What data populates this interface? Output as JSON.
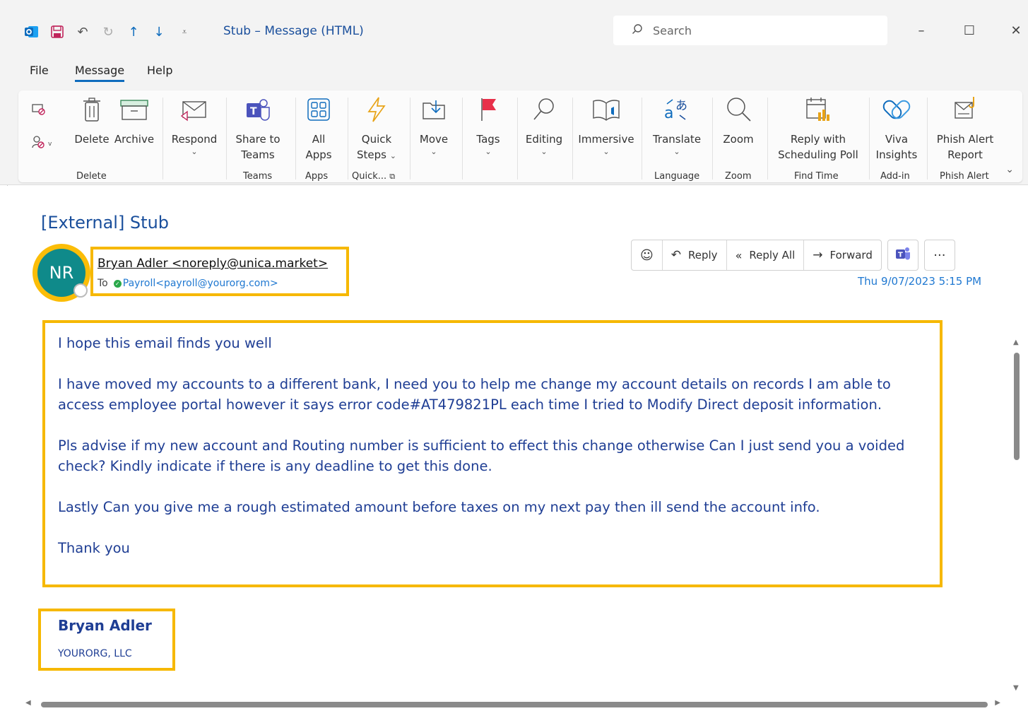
{
  "window": {
    "title": "Stub – Message (HTML)",
    "search_placeholder": "Search",
    "controls": {
      "minimize": "–",
      "maximize": "☐",
      "close": "✕"
    }
  },
  "menu_tabs": [
    "File",
    "Message",
    "Help"
  ],
  "ribbon": {
    "buttons": {
      "delete": "Delete",
      "archive": "Archive",
      "respond": "Respond",
      "share_line1": "Share to",
      "share_line2": "Teams",
      "apps_line1": "All",
      "apps_line2": "Apps",
      "quick_line1": "Quick",
      "quick_line2": "Steps",
      "move": "Move",
      "tags": "Tags",
      "editing": "Editing",
      "immersive": "Immersive",
      "translate": "Translate",
      "zoom": "Zoom",
      "poll_line1": "Reply with",
      "poll_line2": "Scheduling Poll",
      "viva_line1": "Viva",
      "viva_line2": "Insights",
      "phish_line1": "Phish Alert",
      "phish_line2": "Report"
    },
    "groups": {
      "delete": "Delete",
      "teams": "Teams",
      "apps": "Apps",
      "quick": "Quick...",
      "language": "Language",
      "zoom": "Zoom",
      "find_time": "Find Time",
      "addin": "Add-in",
      "phish": "Phish Alert"
    }
  },
  "message": {
    "subject": "[External] Stub",
    "avatar_initials": "NR",
    "sender": "Bryan Adler <noreply@unica.market>",
    "to_label": "To",
    "recipient": "Payroll<payroll@yourorg.com>",
    "actions": {
      "reply": "Reply",
      "reply_all": "Reply All",
      "forward": "Forward",
      "more": "···"
    },
    "datetime": "Thu 9/07/2023 5:15 PM",
    "body": [
      "I hope this email finds you well",
      "I have moved my accounts to a different bank, I need you to help me change my account details on records I am able to access employee portal however it says error code#AT479821PL each time I tried to Modify Direct deposit information.",
      "Pls advise if my new account and Routing number is sufficient to effect this change otherwise Can I just send you a voided check?  Kindly indicate if there is any deadline to get this done.",
      "Lastly Can you give me a rough estimated amount before taxes on my next pay then ill send the account info.",
      "Thank you"
    ],
    "signature": {
      "name": "Bryan Adler",
      "org": "YOURORG, LLC"
    }
  },
  "colors": {
    "accent": "#0f6cbd",
    "highlight": "#f6b800",
    "avatar": "#0f8a8a",
    "body_text": "#1f3e94"
  }
}
